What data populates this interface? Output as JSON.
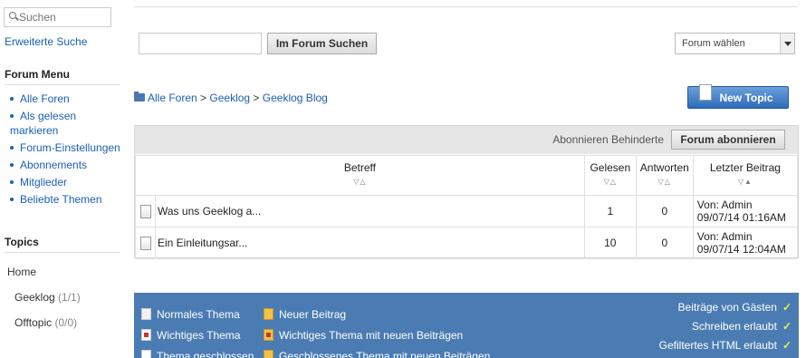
{
  "sidebar": {
    "search_placeholder": "Suchen",
    "advanced_search": "Erweiterte Suche",
    "forum_menu_title": "Forum Menu",
    "menu_items": [
      "Alle Foren",
      "Als gelesen markieren",
      "Forum-Einstellungen",
      "Abonnements",
      "Mitglieder",
      "Beliebte Themen"
    ],
    "topics_title": "Topics",
    "topics": [
      {
        "label": "Home",
        "count": ""
      },
      {
        "label": "Geeklog",
        "count": "(1/1)"
      },
      {
        "label": "Offtopic",
        "count": "(0/0)"
      }
    ]
  },
  "search": {
    "button": "Im Forum Suchen",
    "forum_select": "Forum wählen"
  },
  "breadcrumb": {
    "parts": [
      "Alle Foren",
      "Geeklog",
      "Geeklog Blog"
    ],
    "sep": " > "
  },
  "new_topic_button": "New Topic",
  "subscribe": {
    "disabled_text": "Abonnieren Behinderte",
    "button": "Forum abonnieren"
  },
  "table": {
    "headers": [
      "Betreff",
      "Gelesen",
      "Antworten",
      "Letzter Beitrag"
    ],
    "sort_glyph": "▽△",
    "sort_glyph_active": "▽▲",
    "rows": [
      {
        "subject": "Was uns Geeklog a...",
        "read": "1",
        "replies": "0",
        "last_by": "Von: Admin",
        "last_date": "09/07/14 01:16AM"
      },
      {
        "subject": "Ein Einleitungsar...",
        "read": "10",
        "replies": "0",
        "last_by": "Von: Admin",
        "last_date": "09/07/14 12:04AM"
      }
    ]
  },
  "legend": {
    "items": [
      "Normales Thema",
      "Neuer Beitrag",
      "Wichtiges Thema",
      "Wichtiges Thema mit neuen Beiträgen",
      "Thema geschlossen",
      "Geschlossenes Thema mit neuen Beiträgen"
    ],
    "permissions": [
      "Beiträge von Gästen",
      "Schreiben erlaubt",
      "Gefiltertes HTML erlaubt"
    ],
    "check": "✓"
  }
}
